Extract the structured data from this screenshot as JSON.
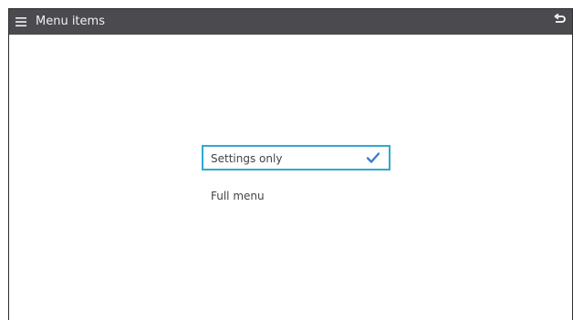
{
  "header": {
    "title": "Menu items",
    "menu_icon": "hamburger-menu-icon",
    "back_icon": "back-arrow-icon"
  },
  "options": [
    {
      "label": "Settings only",
      "selected": true,
      "indicator_icon": "check-icon"
    },
    {
      "label": "Full menu",
      "selected": false
    }
  ],
  "colors": {
    "topbar": "#4a4a4f",
    "title_text": "#f2f2f2",
    "selection_border": "#2fa8d6",
    "check": "#3a7bd5",
    "option_text": "#444444"
  }
}
